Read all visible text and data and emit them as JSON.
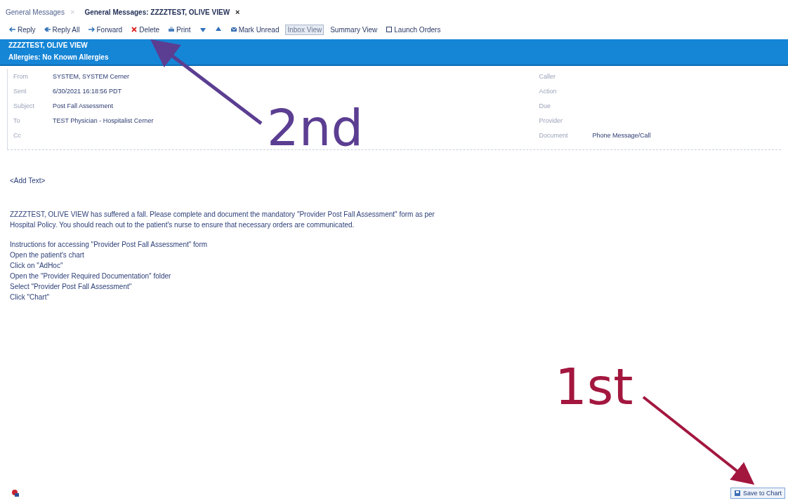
{
  "tabs": [
    {
      "label": "General Messages",
      "selected": false,
      "close": "×"
    },
    {
      "label": "General Messages: ZZZZTEST, OLIVE VIEW",
      "selected": true,
      "close": "×"
    }
  ],
  "toolbar": [
    {
      "label": "Reply",
      "kind": "reply",
      "selected": false
    },
    {
      "label": "Reply All",
      "kind": "reply-all",
      "selected": false
    },
    {
      "label": "Forward",
      "kind": "forward",
      "selected": false
    },
    {
      "label": "Delete",
      "kind": "delete",
      "selected": false
    },
    {
      "label": "Print",
      "kind": "print",
      "selected": false
    },
    {
      "kind": "down",
      "selected": false
    },
    {
      "kind": "up",
      "selected": false
    },
    {
      "label": "Mark Unread",
      "kind": "mark",
      "selected": false
    },
    {
      "label": "Inbox View",
      "kind": "text",
      "selected": true
    },
    {
      "label": "Summary View",
      "kind": "text",
      "selected": false
    },
    {
      "label": "Launch Orders",
      "kind": "launch",
      "selected": false
    }
  ],
  "banner": {
    "patient": "ZZZZTEST, OLIVE VIEW",
    "allergies_label": "Allergies:",
    "allergies": "No Known Allergies"
  },
  "fields_left": [
    {
      "label": "From",
      "value": "SYSTEM, SYSTEM Cerner"
    },
    {
      "label": "Sent",
      "value": "6/30/2021 16:18:56 PDT"
    },
    {
      "label": "Subject",
      "value": "Post Fall Assessment"
    },
    {
      "label": "To",
      "value": "TEST Physician - Hospitalist Cerner"
    },
    {
      "label": "Cc"
    }
  ],
  "fields_right": [
    {
      "label": "Caller"
    },
    {
      "label": "Action"
    },
    {
      "label": "Due"
    },
    {
      "label": "Provider"
    },
    {
      "label": "Document",
      "value": "Phone Message/Call"
    }
  ],
  "body": {
    "add_text": "<Add Text>",
    "paragraphs": [
      [
        "ZZZZTEST, OLIVE VIEW has suffered a fall. Please complete and document the mandatory \"Provider Post Fall Assessment\" form as per",
        "Hospital Policy. You should reach out to the patient's nurse to ensure that necessary orders are communicated."
      ],
      [
        "Instructions for accessing \"Provider Post Fall Assessment\" form",
        "Open the patient's chart",
        "Click on \"AdHoc\"",
        "Open the \"Provider Required Documentation\" folder",
        "Select \"Provider Post Fall Assessment\"",
        "Click \"Chart\""
      ]
    ]
  },
  "footer": {
    "save_button": "Save to Chart"
  },
  "annotations": [
    {
      "label": "2nd",
      "color": "#5b3e92"
    },
    {
      "label": "1st",
      "color": "#a3173f"
    }
  ]
}
